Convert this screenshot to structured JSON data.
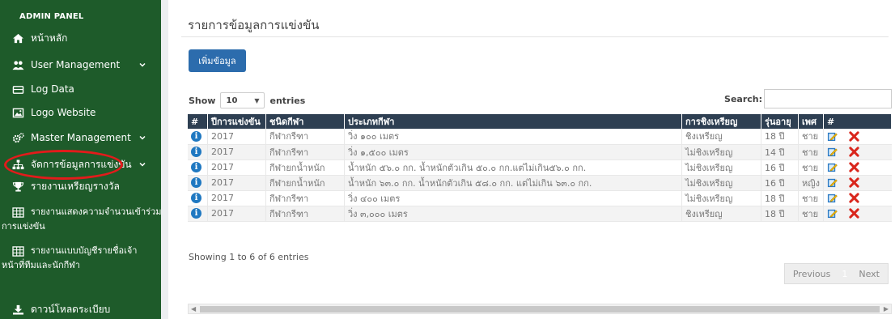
{
  "sidebar": {
    "header": "ADMIN PANEL",
    "items": [
      {
        "label": "หน้าหลัก",
        "icon": "home-icon"
      },
      {
        "label": "User Management",
        "icon": "users-icon"
      },
      {
        "label": "Log Data",
        "icon": "log-icon"
      },
      {
        "label": "Logo Website",
        "icon": "image-icon"
      },
      {
        "label": "Master Management",
        "icon": "gears-icon"
      },
      {
        "label": "จัดการข้อมูลการแข่งขัน",
        "icon": "sitemap-icon"
      },
      {
        "label": "รายงานเหรียญรางวัล",
        "icon": "trophy-icon"
      },
      {
        "label_line1": "รายงานแสดงความจำนวนเข้าร่วม",
        "label_line2": "การแข่งขัน",
        "icon": "table-icon"
      },
      {
        "label_line1": "รายงานแบบบัญชีรายชื่อเจ้า",
        "label_line2": "หน้าที่ทีมและนักกีฬา",
        "icon": "table-icon"
      },
      {
        "label": "ดาวน์โหลดระเบียบ",
        "icon": "download-icon"
      }
    ],
    "highlight_color": "#e21b1b"
  },
  "main": {
    "title": "รายการข้อมูลการแข่งขัน",
    "add_button": "เพิ่มข้อมูล",
    "show_label": "Show",
    "entries_value": "10",
    "entries_label": "entries",
    "search_label": "Search:",
    "search_value": "",
    "columns": [
      "#",
      "ปีการแข่งขัน",
      "ชนิดกีฬา",
      "ประเภทกีฬา",
      "การชิงเหรียญ",
      "รุ่นอายุ",
      "เพศ",
      "#"
    ],
    "rows": [
      {
        "year": "2017",
        "sport": "กีฬากรีฑา",
        "event": "วิ่ง ๑๐๐ เมตร",
        "medal": "ชิงเหรียญ",
        "age": "18 ปี",
        "gender": "ชาย"
      },
      {
        "year": "2017",
        "sport": "กีฬากรีฑา",
        "event": "วิ่ง ๑,๕๐๐ เมตร",
        "medal": "ไม่ชิงเหรียญ",
        "age": "14 ปี",
        "gender": "ชาย"
      },
      {
        "year": "2017",
        "sport": "กีฬายกน้ำหนัก",
        "event": "น้ำหนัก ๕๖.๐ กก. น้ำหนักตัวเกิน ๕๐.๐ กก.แต่ไม่เกิน๕๖.๐ กก.",
        "medal": "ไม่ชิงเหรียญ",
        "age": "16 ปี",
        "gender": "ชาย"
      },
      {
        "year": "2017",
        "sport": "กีฬายกน้ำหนัก",
        "event": "น้ำหนัก ๖๓.๐ กก. น้ำหนักตัวเกิน ๕๘.๐ กก. แต่ไม่เกิน ๖๓.๐ กก.",
        "medal": "ไม่ชิงเหรียญ",
        "age": "16 ปี",
        "gender": "หญิง"
      },
      {
        "year": "2017",
        "sport": "กีฬากรีฑา",
        "event": "วิ่ง ๔๐๐ เมตร",
        "medal": "ไม่ชิงเหรียญ",
        "age": "18 ปี",
        "gender": "ชาย"
      },
      {
        "year": "2017",
        "sport": "กีฬากรีฑา",
        "event": "วิ่ง ๓,๐๐๐ เมตร",
        "medal": "ชิงเหรียญ",
        "age": "18 ปี",
        "gender": "ชาย"
      }
    ],
    "footer_info": "Showing 1 to 6 of 6 entries",
    "pager": {
      "previous": "Previous",
      "page": "1",
      "next": "Next"
    }
  },
  "colors": {
    "sidebar_bg": "#1e5b2a",
    "header_bg": "#2e3f52",
    "button_bg": "#2c6cad",
    "info_icon": "#1f78c1",
    "delete_icon": "#d9261c"
  }
}
